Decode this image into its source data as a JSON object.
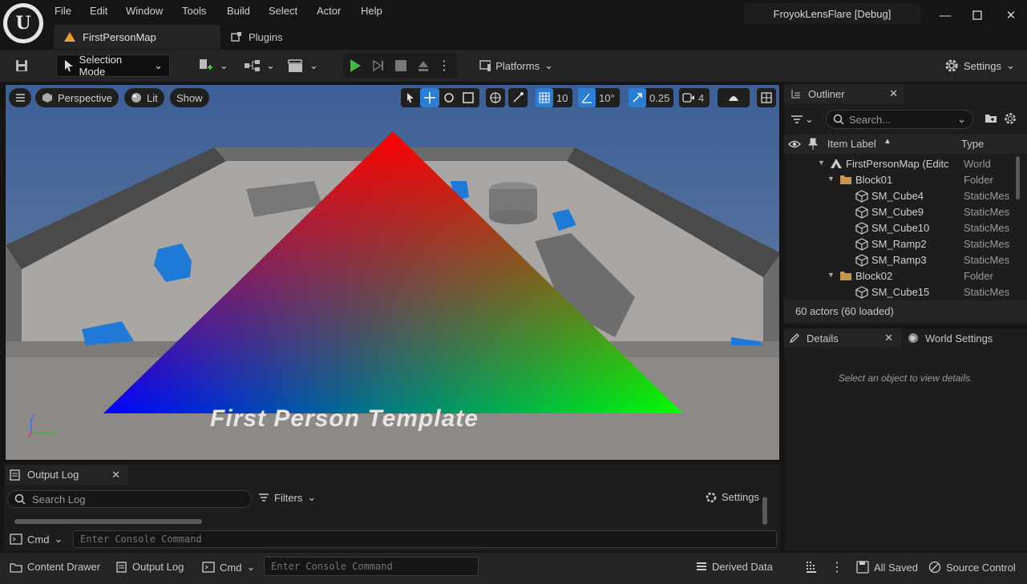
{
  "app": {
    "logo_text": "U",
    "menu": [
      "File",
      "Edit",
      "Window",
      "Tools",
      "Build",
      "Select",
      "Actor",
      "Help"
    ],
    "project_name": "FroyokLensFlare [Debug]",
    "tabs": [
      {
        "label": "FirstPersonMap"
      },
      {
        "label": "Plugins"
      }
    ]
  },
  "toolbar": {
    "selection_mode": "Selection Mode",
    "platforms": "Platforms",
    "settings": "Settings"
  },
  "viewport": {
    "perspective": "Perspective",
    "lit": "Lit",
    "show": "Show",
    "grid_size": "10",
    "rotation_snap": "10°",
    "scale_snap": "0.25",
    "camera_speed": "4",
    "floor_text": "First Person Template",
    "axis_z": "Z",
    "axis_y": "Y"
  },
  "outliner": {
    "title": "Outliner",
    "search_placeholder": "Search...",
    "col_label": "Item Label",
    "col_type": "Type",
    "rows": [
      {
        "label": "FirstPersonMap (Editc",
        "type": "World",
        "indent": 0,
        "icon": "world"
      },
      {
        "label": "Block01",
        "type": "Folder",
        "indent": 1,
        "icon": "folder"
      },
      {
        "label": "SM_Cube4",
        "type": "StaticMes",
        "indent": 2,
        "icon": "mesh"
      },
      {
        "label": "SM_Cube9",
        "type": "StaticMes",
        "indent": 2,
        "icon": "mesh"
      },
      {
        "label": "SM_Cube10",
        "type": "StaticMes",
        "indent": 2,
        "icon": "mesh"
      },
      {
        "label": "SM_Ramp2",
        "type": "StaticMes",
        "indent": 2,
        "icon": "mesh"
      },
      {
        "label": "SM_Ramp3",
        "type": "StaticMes",
        "indent": 2,
        "icon": "mesh"
      },
      {
        "label": "Block02",
        "type": "Folder",
        "indent": 1,
        "icon": "folder"
      },
      {
        "label": "SM_Cube15",
        "type": "StaticMes",
        "indent": 2,
        "icon": "mesh"
      }
    ],
    "actor_count": "60 actors (60 loaded)"
  },
  "details": {
    "tab_details": "Details",
    "tab_world": "World Settings",
    "empty_msg": "Select an object to view details."
  },
  "output_log": {
    "title": "Output Log",
    "search_placeholder": "Search Log",
    "filters": "Filters",
    "settings": "Settings",
    "cmd": "Cmd",
    "console_placeholder": "Enter Console Command"
  },
  "statusbar": {
    "content_drawer": "Content Drawer",
    "output_log": "Output Log",
    "cmd": "Cmd",
    "console_placeholder": "Enter Console Command",
    "derived_data": "Derived Data",
    "all_saved": "All Saved",
    "source_control": "Source Control"
  },
  "colors": {
    "accent_green": "#3fb83f",
    "accent_blue": "#2a7fd4",
    "panel": "#1d1d1d"
  }
}
